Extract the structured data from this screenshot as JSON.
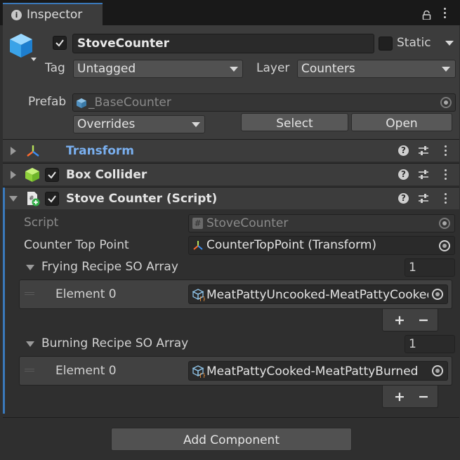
{
  "tab": {
    "label": "Inspector"
  },
  "gameobject": {
    "active": true,
    "name": "StoveCounter",
    "static_label": "Static",
    "tag_label": "Tag",
    "tag_value": "Untagged",
    "layer_label": "Layer",
    "layer_value": "Counters"
  },
  "prefab": {
    "label": "Prefab",
    "asset": "_BaseCounter",
    "overrides_label": "Overrides",
    "select_label": "Select",
    "open_label": "Open"
  },
  "components": {
    "transform": {
      "name": "Transform",
      "expanded": false
    },
    "box_collider": {
      "name": "Box Collider",
      "enabled": true,
      "expanded": false
    },
    "stove_counter": {
      "name": "Stove Counter (Script)",
      "enabled": true,
      "expanded": true,
      "script_label": "Script",
      "script_value": "StoveCounter",
      "counter_top_label": "Counter Top Point",
      "counter_top_value": "CounterTopPoint (Transform)",
      "frying": {
        "label": "Frying Recipe SO Array",
        "size": "1",
        "elements": [
          {
            "label": "Element 0",
            "value": "MeatPattyUncooked-MeatPattyCooked"
          }
        ]
      },
      "burning": {
        "label": "Burning Recipe SO Array",
        "size": "1",
        "elements": [
          {
            "label": "Element 0",
            "value": "MeatPattyCooked-MeatPattyBurned"
          }
        ]
      }
    }
  },
  "add_component_label": "Add Component",
  "list_buttons": {
    "add": "+",
    "remove": "−"
  },
  "colors": {
    "panel": "#2f2f2f",
    "header": "#3c3c3c",
    "field": "#2a2a2a",
    "transform_link": "#7ab0f0",
    "focus_bar": "#3a79bb"
  }
}
